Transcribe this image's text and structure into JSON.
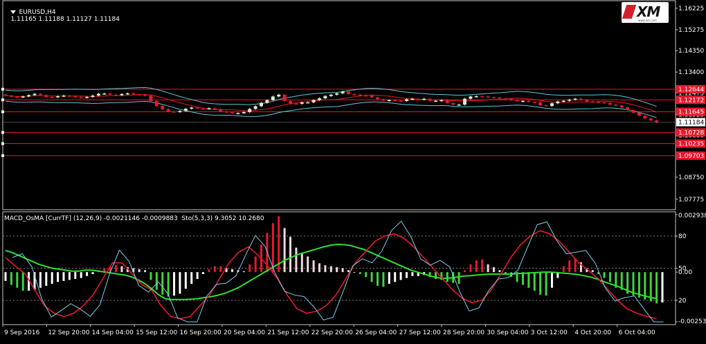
{
  "header": {
    "symbol": "EURUSD,H4",
    "ohlc": [
      "1.11165",
      "1.11188",
      "1.11127",
      "1.11184"
    ]
  },
  "logo": {
    "text": "XM",
    "subtext": "www.xm.com"
  },
  "price_axis": {
    "ticks": [
      "1.16225",
      "1.15275",
      "1.14350",
      "1.13400",
      "1.12475",
      "1.11525",
      "1.10600",
      "1.08750",
      "1.07775"
    ],
    "current_price": "1.11184",
    "levels": [
      {
        "value": "1.12644",
        "color": "#e8182c"
      },
      {
        "value": "1.12172",
        "color": "#e8182c"
      },
      {
        "value": "1.11645",
        "color": "#e8182c"
      },
      {
        "value": "1.10728",
        "color": "#e8182c"
      },
      {
        "value": "1.10235",
        "color": "#e8182c"
      },
      {
        "value": "1.09703",
        "color": "#e8182c"
      }
    ]
  },
  "indicator": {
    "title": "MACD_OsMA [CurrTF] (12,26,9) -0.0021146 -0.0009883  Sto(5,3,3) 9.3052 10.2680",
    "axis_ticks": [
      "0.002938",
      "80",
      "50",
      "0.00",
      "20",
      "-0.002539"
    ]
  },
  "time_axis": [
    "9 Sep 2016",
    "12 Sep 20:00",
    "14 Sep 04:00",
    "15 Sep 12:00",
    "16 Sep 20:00",
    "20 Sep 04:00",
    "21 Sep 12:00",
    "22 Sep 20:00",
    "26 Sep 04:00",
    "27 Sep 12:00",
    "28 Sep 20:00",
    "30 Sep 04:00",
    "3 Oct 12:00",
    "4 Oct 20:00",
    "6 Oct 04:00"
  ],
  "colors": {
    "background": "#000000",
    "bull_candle": "#d8f0d0",
    "bear_candle": "#e8182c",
    "bollinger": "#5ec8e0",
    "bollinger_mid": "#e8182c",
    "macd_pos_light": "#f2d8e0",
    "macd_pos_strong": "#e8182c",
    "macd_neg_light": "#ffffff",
    "macd_neg_strong": "#3ed43e",
    "signal_line": "#2ee02e",
    "stoch_main": "#e8182c",
    "stoch_signal": "#7ad0f0"
  },
  "chart_data": [
    {
      "type": "candlestick",
      "title": "EURUSD,H4",
      "y_range": [
        1.074,
        1.165
      ],
      "close": [
        1.1236,
        1.1231,
        1.1229,
        1.1232,
        1.1238,
        1.1244,
        1.1238,
        1.123,
        1.1229,
        1.1233,
        1.1236,
        1.1233,
        1.1229,
        1.1227,
        1.123,
        1.1236,
        1.1244,
        1.1245,
        1.124,
        1.1238,
        1.1243,
        1.1246,
        1.1242,
        1.124,
        1.1236,
        1.1212,
        1.119,
        1.1176,
        1.1166,
        1.1163,
        1.1168,
        1.1178,
        1.1183,
        1.1179,
        1.1178,
        1.118,
        1.1176,
        1.1166,
        1.1162,
        1.1158,
        1.1158,
        1.1163,
        1.1177,
        1.1189,
        1.1204,
        1.1216,
        1.1232,
        1.124,
        1.1212,
        1.1201,
        1.12,
        1.1206,
        1.1206,
        1.1216,
        1.1224,
        1.1234,
        1.124,
        1.1246,
        1.1254,
        1.1243,
        1.124,
        1.1237,
        1.1236,
        1.1228,
        1.122,
        1.1214,
        1.1216,
        1.1214,
        1.1212,
        1.122,
        1.1222,
        1.1218,
        1.1222,
        1.1213,
        1.1213,
        1.1216,
        1.1203,
        1.1196,
        1.1196,
        1.1222,
        1.1232,
        1.1233,
        1.1232,
        1.1229,
        1.1227,
        1.1223,
        1.1221,
        1.1216,
        1.1212,
        1.1212,
        1.1208,
        1.1206,
        1.1193,
        1.119,
        1.1202,
        1.121,
        1.1213,
        1.1218,
        1.1222,
        1.1217,
        1.121,
        1.1208,
        1.1206,
        1.1204,
        1.1196,
        1.1192,
        1.1184,
        1.1172,
        1.116,
        1.1147,
        1.1135,
        1.1126,
        1.1118
      ]
    },
    {
      "type": "bar+line",
      "title": "MACD_OsMA [CurrTF] (12,26,9) / Sto(5,3,3)",
      "y_range": [
        -0.002539,
        0.002938
      ],
      "stoch_levels": [
        20,
        50,
        80
      ],
      "osma": [
        -0.00045,
        -0.00065,
        -0.0008,
        -0.00095,
        -0.00095,
        -0.0009,
        -0.0008,
        -0.0007,
        -0.0006,
        -0.0005,
        -0.00045,
        -0.0004,
        -0.00035,
        -0.0003,
        -0.0002,
        -0.0001,
        0.0001,
        0.0002,
        0.0003,
        0.00035,
        0.0003,
        0.00025,
        0.0002,
        0.00015,
        0.0001,
        -0.0004,
        -0.0009,
        -0.00115,
        -0.00125,
        -0.0012,
        -0.0011,
        -0.00085,
        -0.0006,
        -0.00035,
        -0.0001,
        0.00015,
        0.0003,
        0.0003,
        0.0002,
        0.00015,
        0.0001,
        5e-05,
        0.0004,
        0.0008,
        0.0014,
        0.002,
        0.0025,
        0.00285,
        0.00225,
        0.0018,
        0.00125,
        0.001,
        0.0008,
        0.0006,
        0.00045,
        0.00035,
        0.0003,
        0.00025,
        0.0002,
        0.0001,
        0.0,
        -0.0001,
        -0.00025,
        -0.0005,
        -0.0007,
        -0.00075,
        -0.0006,
        -0.0005,
        -0.0004,
        -0.0003,
        -0.0002,
        -0.0002,
        -0.00015,
        -0.00025,
        -0.00035,
        -0.0004,
        -0.0005,
        -0.00055,
        -0.0006,
        0.0001,
        0.0004,
        0.0006,
        0.00065,
        0.0004,
        0.00025,
        0.0001,
        -0.0001,
        -0.00025,
        -0.0005,
        -0.00065,
        -0.0008,
        -0.00095,
        -0.00115,
        -0.0012,
        -0.0008,
        -0.0003,
        0.0003,
        0.0006,
        0.0007,
        0.0005,
        0.0002,
        0.0001,
        -0.0001,
        -0.0003,
        -0.0005,
        -0.0008,
        -0.0009,
        -0.0011,
        -0.0012,
        -0.0013,
        -0.0014,
        -0.0015,
        -0.0016,
        -0.00155
      ],
      "signal": [
        0.0011,
        0.001,
        0.00085,
        0.0007,
        0.00055,
        0.0004,
        0.0003,
        0.0002,
        0.00015,
        0.0001,
        5e-05,
        5e-05,
        0.0001,
        0.0001,
        5e-05,
        0.0,
        -5e-05,
        -0.0001,
        -0.00015,
        -0.00025,
        -0.0004,
        -0.0006,
        -0.00085,
        -0.00115,
        -0.00135,
        -0.0014,
        -0.0014,
        -0.0014,
        -0.00138,
        -0.00135,
        -0.0013,
        -0.00125,
        -0.00118,
        -0.00108,
        -0.00095,
        -0.0008,
        -0.0006,
        -0.0004,
        -0.0002,
        0.0,
        0.0002,
        0.0004,
        0.0006,
        0.00075,
        0.0009,
        0.001,
        0.0011,
        0.0012,
        0.0013,
        0.00138,
        0.00142,
        0.0014,
        0.00135,
        0.00125,
        0.00115,
        0.001,
        0.00085,
        0.0007,
        0.00055,
        0.0004,
        0.00025,
        0.0001,
        0.0,
        -0.0001,
        -0.0002,
        -0.00028,
        -0.00032,
        -0.0003,
        -0.00025,
        -0.0002,
        -0.00018,
        -0.00015,
        -0.00012,
        -0.0001,
        -0.0001,
        -0.0001,
        -0.0001,
        -8e-05,
        -6e-05,
        -4e-05,
        -2e-05,
        0.0,
        0.0,
        -2e-05,
        -5e-05,
        -8e-05,
        -0.00012,
        -0.00018,
        -0.00025,
        -0.00035,
        -0.00048,
        -0.0006,
        -0.0007,
        -0.00085,
        -0.001,
        -0.0011,
        -0.0012,
        -0.00128,
        -0.00135
      ],
      "stoch_main": [
        60,
        52,
        45,
        30,
        15,
        8,
        5,
        8,
        15,
        25,
        40,
        55,
        55,
        45,
        35,
        30,
        15,
        5,
        3,
        5,
        15,
        25,
        40,
        55,
        65,
        70,
        62,
        52,
        40,
        25,
        12,
        8,
        10,
        15,
        25,
        40,
        55,
        65,
        75,
        80,
        82,
        78,
        70,
        60,
        50,
        40,
        30,
        22,
        18,
        20,
        30,
        45,
        60,
        72,
        80,
        85,
        82,
        75,
        65,
        55,
        48,
        40,
        30,
        20,
        12,
        8,
        5,
        3
      ]
    }
  ]
}
